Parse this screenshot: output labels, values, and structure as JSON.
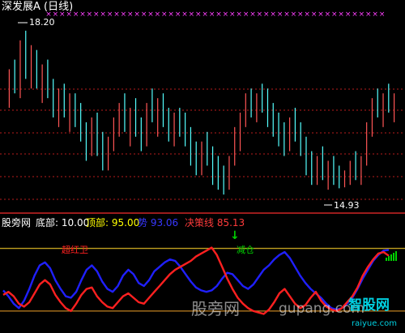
{
  "top": {
    "title": "深发展A (日线)",
    "high_label": "18.20",
    "low_label": "14.93",
    "colors": {
      "up": "#ff5555",
      "down": "#54ffff",
      "marker": "#ff40ff",
      "title": "#ffffff",
      "axis": "#c0c0c0",
      "dash": "#b71c1c"
    },
    "marker_symbol": "×",
    "markers_count": 50
  },
  "indicator": {
    "site_label": "股旁网",
    "params": [
      {
        "label": "底部:",
        "value": "10.00",
        "color": "#ffffff"
      },
      {
        "label": "顶部:",
        "value": "95.00",
        "color": "#ffff00"
      },
      {
        "label": "势",
        "value": "93.06",
        "color": "#3838ff"
      },
      {
        "label": "决策线",
        "value": "85.13",
        "color": "#ff3b3b"
      }
    ],
    "annotations": {
      "left_text": "超红卫",
      "cut_text": "减仓",
      "arrow": "↓"
    },
    "colors": {
      "line_top": "#c0a020",
      "line_bottom": "#c08020",
      "blue": "#2020ff",
      "red": "#ff2020",
      "green": "#00d000"
    }
  },
  "watermarks": {
    "left": "股旁网",
    "mid": "gupang.com",
    "right_cn": "智股网",
    "right_en": "raiyue.com"
  },
  "chart_data": [
    {
      "type": "bar",
      "title": "深发展A (日线)",
      "series": [
        {
          "name": "daily bars",
          "points": [
            [
              17.0,
              17.4,
              16.6,
              17.2
            ],
            [
              17.2,
              17.6,
              16.9,
              17.0
            ],
            [
              17.0,
              18.0,
              16.8,
              17.8
            ],
            [
              17.8,
              18.2,
              17.2,
              17.4
            ],
            [
              17.4,
              17.9,
              17.0,
              17.6
            ],
            [
              17.6,
              17.8,
              17.0,
              17.1
            ],
            [
              17.1,
              17.5,
              16.7,
              17.3
            ],
            [
              17.3,
              17.6,
              16.8,
              16.9
            ],
            [
              16.9,
              17.2,
              16.4,
              16.6
            ],
            [
              16.6,
              17.0,
              16.2,
              16.8
            ],
            [
              16.8,
              17.1,
              16.4,
              16.5
            ],
            [
              16.5,
              16.9,
              16.1,
              16.7
            ],
            [
              16.7,
              16.9,
              16.2,
              16.3
            ],
            [
              16.3,
              16.7,
              15.9,
              16.0
            ],
            [
              16.0,
              16.3,
              15.5,
              15.8
            ],
            [
              15.8,
              16.4,
              15.6,
              16.2
            ],
            [
              16.2,
              16.5,
              15.6,
              15.7
            ],
            [
              15.7,
              16.1,
              15.3,
              15.5
            ],
            [
              15.5,
              16.0,
              15.3,
              15.9
            ],
            [
              15.9,
              16.4,
              15.7,
              16.3
            ],
            [
              16.3,
              16.7,
              16.0,
              16.6
            ],
            [
              16.6,
              16.9,
              16.1,
              16.2
            ],
            [
              16.2,
              16.6,
              15.8,
              16.5
            ],
            [
              16.5,
              16.8,
              16.0,
              16.1
            ],
            [
              16.1,
              16.4,
              15.7,
              15.9
            ],
            [
              15.9,
              16.7,
              15.8,
              16.6
            ],
            [
              16.6,
              17.0,
              16.3,
              16.4
            ],
            [
              16.4,
              16.8,
              16.0,
              16.7
            ],
            [
              16.7,
              16.9,
              16.2,
              16.3
            ],
            [
              16.3,
              16.6,
              15.9,
              16.1
            ],
            [
              16.1,
              16.5,
              15.8,
              16.4
            ],
            [
              16.4,
              16.6,
              16.0,
              16.2
            ],
            [
              16.2,
              16.5,
              15.8,
              16.0
            ],
            [
              16.0,
              16.2,
              15.4,
              15.6
            ],
            [
              15.6,
              15.9,
              15.2,
              15.4
            ],
            [
              15.4,
              15.9,
              15.2,
              15.8
            ],
            [
              15.8,
              16.1,
              15.4,
              15.5
            ],
            [
              15.5,
              15.8,
              15.0,
              15.3
            ],
            [
              15.3,
              15.6,
              14.9,
              15.1
            ],
            [
              15.1,
              15.4,
              14.8,
              15.0
            ],
            [
              15.0,
              15.6,
              14.9,
              15.5
            ],
            [
              15.5,
              16.2,
              15.4,
              16.0
            ],
            [
              16.0,
              16.5,
              15.7,
              16.4
            ],
            [
              16.4,
              16.9,
              16.2,
              16.8
            ],
            [
              16.8,
              17.0,
              16.4,
              16.6
            ],
            [
              16.6,
              16.9,
              16.3,
              16.8
            ],
            [
              16.8,
              17.1,
              16.5,
              16.7
            ],
            [
              16.7,
              17.0,
              16.2,
              16.4
            ],
            [
              16.4,
              16.7,
              16.0,
              16.2
            ],
            [
              16.2,
              16.5,
              15.8,
              16.0
            ],
            [
              16.0,
              16.3,
              15.6,
              15.8
            ],
            [
              15.8,
              16.4,
              15.7,
              16.3
            ],
            [
              16.3,
              16.6,
              15.9,
              16.1
            ],
            [
              16.1,
              16.3,
              15.6,
              15.7
            ],
            [
              15.7,
              16.0,
              15.2,
              15.4
            ],
            [
              15.4,
              15.7,
              15.0,
              15.3
            ],
            [
              15.3,
              15.6,
              15.0,
              15.5
            ],
            [
              15.5,
              15.8,
              15.1,
              15.2
            ],
            [
              15.2,
              15.5,
              14.9,
              15.3
            ],
            [
              15.3,
              15.6,
              15.0,
              15.1
            ],
            [
              15.1,
              15.4,
              14.93,
              15.0
            ],
            [
              15.0,
              15.3,
              14.95,
              15.2
            ],
            [
              15.2,
              15.5,
              15.0,
              15.4
            ],
            [
              15.4,
              15.7,
              15.1,
              15.2
            ],
            [
              15.2,
              15.6,
              15.0,
              15.5
            ],
            [
              15.5,
              16.3,
              15.4,
              16.2
            ],
            [
              16.2,
              16.8,
              16.0,
              16.7
            ],
            [
              16.7,
              17.0,
              16.4,
              16.5
            ],
            [
              16.5,
              16.9,
              16.2,
              16.8
            ],
            [
              16.8,
              17.1,
              16.5,
              16.6
            ],
            [
              16.6,
              16.9,
              16.3,
              16.8
            ]
          ]
        }
      ],
      "point_format": [
        "open",
        "high",
        "low",
        "close"
      ],
      "annotations": [
        "18.20",
        "14.93"
      ]
    },
    {
      "type": "line",
      "series": [
        {
          "name": "势",
          "values": [
            38,
            30,
            20,
            14,
            24,
            40,
            58,
            72,
            76,
            68,
            52,
            40,
            30,
            28,
            36,
            52,
            66,
            72,
            64,
            50,
            40,
            36,
            44,
            58,
            66,
            60,
            48,
            44,
            52,
            64,
            70,
            76,
            80,
            78,
            70,
            60,
            50,
            42,
            38,
            36,
            38,
            44,
            54,
            62,
            60,
            52,
            44,
            40,
            46,
            56,
            66,
            72,
            80,
            86,
            90,
            82,
            70,
            58,
            48,
            40,
            34,
            28,
            20,
            14,
            12,
            14,
            20,
            28,
            40,
            54,
            66,
            78,
            86,
            92,
            93
          ]
        },
        {
          "name": "决策线",
          "values": [
            32,
            36,
            30,
            20,
            16,
            22,
            34,
            46,
            52,
            46,
            32,
            22,
            14,
            10,
            20,
            32,
            40,
            42,
            30,
            22,
            16,
            14,
            22,
            30,
            34,
            28,
            22,
            20,
            28,
            36,
            44,
            52,
            60,
            66,
            70,
            74,
            78,
            84,
            88,
            92,
            96,
            86,
            70,
            54,
            40,
            28,
            20,
            14,
            10,
            8,
            6,
            12,
            22,
            34,
            40,
            30,
            20,
            14,
            18,
            28,
            36,
            24,
            16,
            12,
            10,
            14,
            22,
            30,
            42,
            58,
            70,
            80,
            88,
            90,
            85
          ]
        }
      ],
      "levels": {
        "底部": 10.0,
        "顶部": 95.0
      }
    }
  ]
}
